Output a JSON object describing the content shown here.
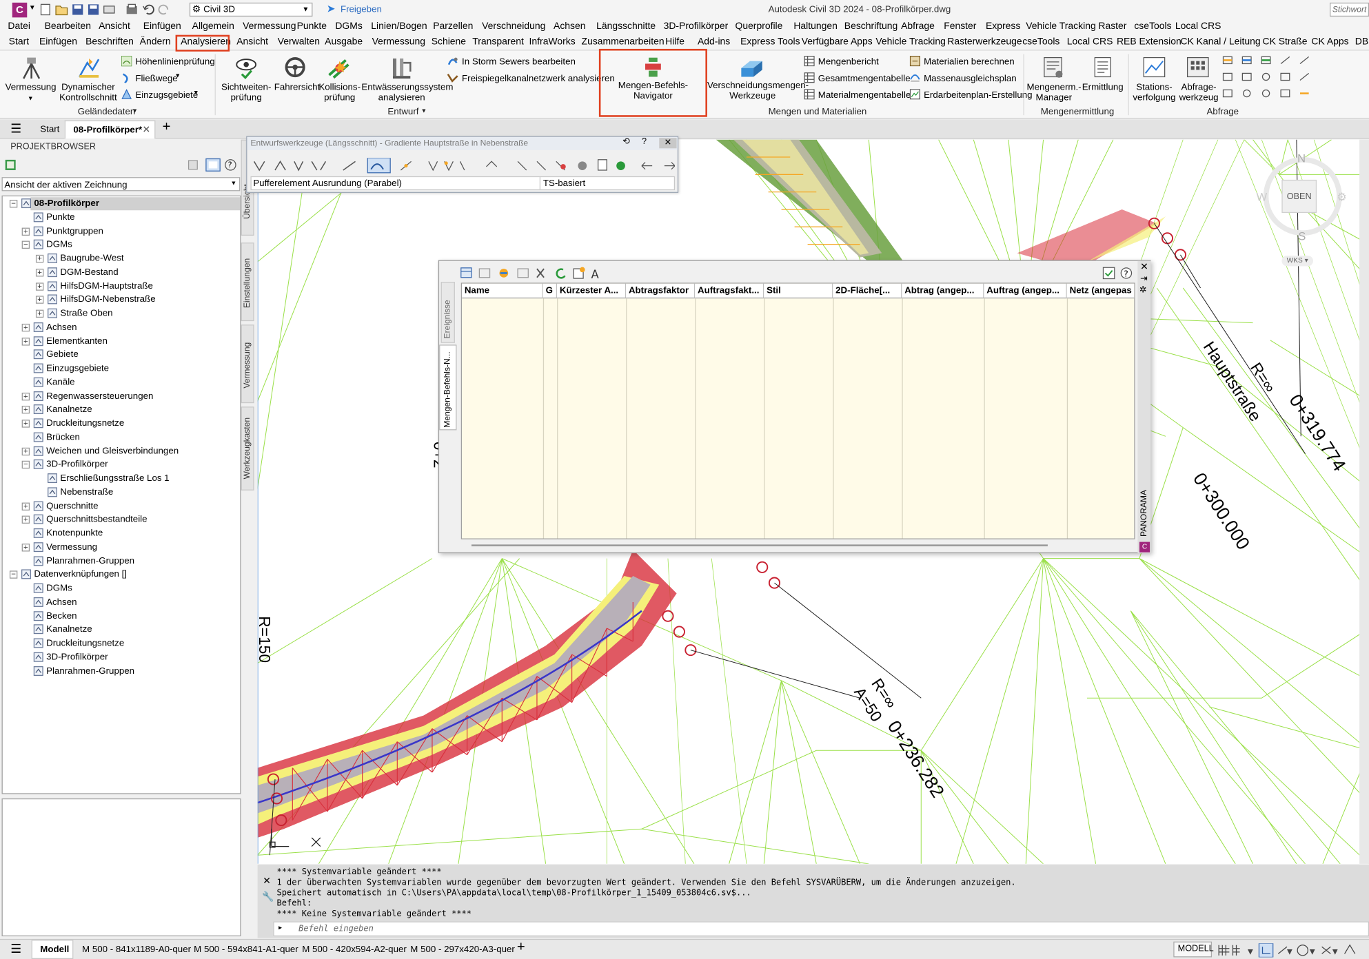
{
  "titlebar": {
    "app_title": "Autodesk Civil 3D 2024 - 08-Profilkörper.dwg",
    "workspace": "Civil 3D",
    "share_label": "Freigeben",
    "search_placeholder": "Stichwort od"
  },
  "menubar": [
    "Datei",
    "Bearbeiten",
    "Ansicht",
    "Einfügen",
    "Allgemein",
    "Vermessung",
    "Punkte",
    "DGMs",
    "Linien/Bogen",
    "Parzellen",
    "Verschneidung",
    "Achsen",
    "Längsschnitte",
    "3D-Profilkörper",
    "Querprofile",
    "Haltungen",
    "Beschriftung",
    "Abfrage",
    "Fenster",
    "Express",
    "Vehicle Tracking",
    "Raster",
    "cseTools",
    "Local CRS"
  ],
  "ribbon_tabs": [
    "Start",
    "Einfügen",
    "Beschriften",
    "Ändern",
    "Analysieren",
    "Ansicht",
    "Verwalten",
    "Ausgabe",
    "Vermessung",
    "Schiene",
    "Transparent",
    "InfraWorks",
    "Zusammenarbeiten",
    "Hilfe",
    "Add-ins",
    "Express Tools",
    "Verfügbare Apps",
    "Vehicle Tracking",
    "Rasterwerkzeuge",
    "cseTools",
    "Local CRS",
    "REB Extension",
    "CK Kanal / Leitung",
    "CK Straße",
    "CK Apps",
    "DBB"
  ],
  "ribbon_active_tab": "Analysieren",
  "ribbon": {
    "gelaende": {
      "title": "Geländedaten",
      "vermessung": "Vermessung",
      "dyn": "Dynamischer Kontrollschnitt",
      "hoehen": "Höhenlinienprüfung",
      "fliess": "Fließwege",
      "einzug": "Einzugsgebiete"
    },
    "entwurf": {
      "title": "Entwurf",
      "sicht": "Sichtweiten-prüfung",
      "fahr": "Fahrersicht",
      "koll": "Kollisions-prüfung",
      "entw": "Entwässerungssystem analysieren",
      "storm": "In Storm Sewers bearbeiten",
      "freisp": "Freispiegelkanalnetzwerk analysieren"
    },
    "mengen": {
      "title": "Mengen und Materialien",
      "nav": "Mengen-Befehls-Navigator",
      "versch": "Verschneidungsmengen-Werkzeuge",
      "bericht": "Mengenbericht",
      "gesamt": "Gesamtmengentabelle",
      "material": "Materialmengentabelle",
      "mat_ber": "Materialien berechnen",
      "massen": "Massenausgleichsplan",
      "erd": "Erdarbeitenplan-Erstellung"
    },
    "ermittlung": {
      "title": "Mengenermittlung",
      "manager": "Mengenerm.-Manager",
      "ermitt": "Ermittlung"
    },
    "abfrage": {
      "title": "Abfrage",
      "stations": "Stations-verfolgung",
      "werkzeug": "Abfrage-werkzeug"
    }
  },
  "doc_tabs": {
    "start": "Start",
    "active": "08-Profilkörper*"
  },
  "browser": {
    "title": "PROJEKTBROWSER",
    "view_select": "Ansicht der aktiven Zeichnung",
    "side_tabs": [
      "Übersicht",
      "Einstellungen",
      "Vermessung",
      "Werkzeugkasten"
    ],
    "tree": [
      {
        "label": "08-Profilkörper",
        "level": 0,
        "bold": true
      },
      {
        "label": "Punkte",
        "level": 1
      },
      {
        "label": "Punktgruppen",
        "level": 1
      },
      {
        "label": "DGMs",
        "level": 1
      },
      {
        "label": "Baugrube-West",
        "level": 2
      },
      {
        "label": "DGM-Bestand",
        "level": 2
      },
      {
        "label": "HilfsDGM-Hauptstraße",
        "level": 2
      },
      {
        "label": "HilfsDGM-Nebenstraße",
        "level": 2
      },
      {
        "label": "Straße Oben",
        "level": 2
      },
      {
        "label": "Achsen",
        "level": 1
      },
      {
        "label": "Elementkanten",
        "level": 1
      },
      {
        "label": "Gebiete",
        "level": 1
      },
      {
        "label": "Einzugsgebiete",
        "level": 1
      },
      {
        "label": "Kanäle",
        "level": 1
      },
      {
        "label": "Regenwassersteuerungen",
        "level": 1
      },
      {
        "label": "Kanalnetze",
        "level": 1
      },
      {
        "label": "Druckleitungsnetze",
        "level": 1
      },
      {
        "label": "Brücken",
        "level": 1
      },
      {
        "label": "Weichen und Gleisverbindungen",
        "level": 1
      },
      {
        "label": "3D-Profilkörper",
        "level": 1
      },
      {
        "label": "Erschließungsstraße Los 1",
        "level": 2
      },
      {
        "label": "Nebenstraße",
        "level": 2
      },
      {
        "label": "Querschnitte",
        "level": 1
      },
      {
        "label": "Querschnittsbestandteile",
        "level": 1
      },
      {
        "label": "Knotenpunkte",
        "level": 1
      },
      {
        "label": "Vermessung",
        "level": 1
      },
      {
        "label": "Planrahmen-Gruppen",
        "level": 1
      },
      {
        "label": "Datenverknüpfungen []",
        "level": 0
      },
      {
        "label": "DGMs",
        "level": 1
      },
      {
        "label": "Achsen",
        "level": 1
      },
      {
        "label": "Becken",
        "level": 1
      },
      {
        "label": "Kanalnetze",
        "level": 1
      },
      {
        "label": "Druckleitungsnetze",
        "level": 1
      },
      {
        "label": "3D-Profilkörper",
        "level": 1
      },
      {
        "label": "Planrahmen-Gruppen",
        "level": 1
      }
    ]
  },
  "ewz": {
    "title": "Entwurfswerkzeuge (Längsschnitt) - Gradiente Hauptstraße in Nebenstraße",
    "field1": "Pufferelement Ausrundung (Parabel)",
    "field2": "TS-basiert"
  },
  "panorama": {
    "columns": [
      "Name",
      "G",
      "Kürzester A...",
      "Abtragsfaktor",
      "Auftragsfakt...",
      "Stil",
      "2D-Fläche[...",
      "Abtrag (angep...",
      "Auftrag (angep...",
      "Netz (angepas"
    ],
    "side_tabs": [
      "Ereignisse",
      "Mengen-Befehls-N..."
    ],
    "label": "PANORAMA"
  },
  "drawing": {
    "labels": {
      "hauptstrasse": "Hauptstraße",
      "r_inf": "R=∞",
      "st_319": "0+319.774",
      "st_300": "0+300.000",
      "st_236": "0+236.282",
      "r_inf2": "R=∞",
      "a50": "A=50",
      "r150": "R=150",
      "st_left": "0+2"
    },
    "viewcube": {
      "n": "N",
      "s": "S",
      "w": "W",
      "top": "OBEN",
      "wks": "WKS"
    }
  },
  "command": {
    "lines": [
      "**** Systemvariable geändert ****",
      "1 der überwachten Systemvariablen wurde gegenüber dem bevorzugten Wert geändert. Verwenden Sie den Befehl SYSVARÜBERW, um die Änderungen anzuzeigen.",
      "Speichert automatisch in C:\\Users\\PA\\appdata\\local\\temp\\08-Profilkörper_1_15409_053804c6.sv$...",
      "Befehl:",
      "**** Keine Systemvariable geändert ****"
    ],
    "placeholder": "Befehl eingeben"
  },
  "status": {
    "layouts": [
      "Modell",
      "M 500 - 841x1189-A0-quer",
      "M 500 - 594x841-A1-quer",
      "M 500 - 420x594-A2-quer",
      "M 500 - 297x420-A3-quer"
    ],
    "mode": "MODELL"
  },
  "colors": {
    "highlight": "#e0401f",
    "surface": "#9be04a",
    "corridor_red": "#d8303c",
    "centerline": "#3a36c8",
    "app_icon": "#a0257d"
  }
}
